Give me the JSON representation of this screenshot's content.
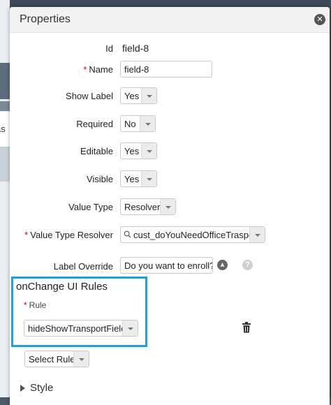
{
  "background": {
    "partial_text": "as"
  },
  "modal": {
    "title": "Properties",
    "close_icon": "close-icon"
  },
  "fields": {
    "id": {
      "label": "Id",
      "value": "field-8"
    },
    "name": {
      "label": "Name",
      "required_mark": "*",
      "value": "field-8"
    },
    "show_label": {
      "label": "Show Label",
      "value": "Yes"
    },
    "required": {
      "label": "Required",
      "value": "No"
    },
    "editable": {
      "label": "Editable",
      "value": "Yes"
    },
    "visible": {
      "label": "Visible",
      "value": "Yes"
    },
    "value_type": {
      "label": "Value Type",
      "value": "Resolver"
    },
    "value_type_resolver": {
      "label": "Value Type Resolver",
      "required_mark": "*",
      "value": "cust_doYouNeedOfficeTrasport",
      "icon": "search-icon"
    },
    "label_override": {
      "label": "Label Override",
      "value": "Do you want to enroll?",
      "icons": [
        "translate-icon",
        "help-icon"
      ]
    }
  },
  "onchange_rules": {
    "title": "onChange UI Rules",
    "rule_label": "Rule",
    "required_mark": "*",
    "rule_value": "hideShowTransportFields",
    "delete_icon": "trash-icon",
    "highlight_color": "#1ea1d6"
  },
  "select_rule": {
    "value": "Select Rule"
  },
  "style_section": {
    "label": "Style",
    "icon": "expand-triangle-icon"
  },
  "colors": {
    "required": "#d0021b",
    "accent": "#1ea1d6"
  }
}
